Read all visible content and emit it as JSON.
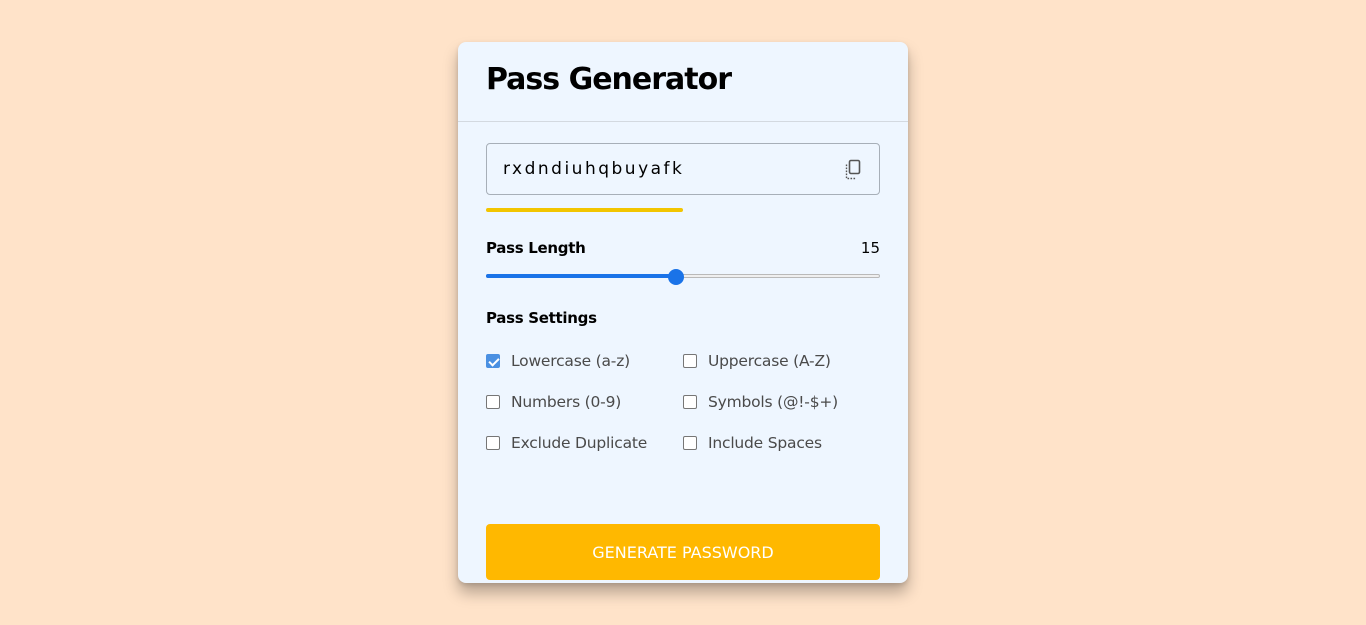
{
  "app": {
    "title": "Pass Generator"
  },
  "password": {
    "value": "rxdndiuhqbuyafk",
    "copy_icon": "copy-icon",
    "strength_fraction": 0.5,
    "strength_color": "#f2c500"
  },
  "length": {
    "label": "Pass Length",
    "value": "15",
    "min": 1,
    "max": 30,
    "current": 15,
    "accent": "#1a73e8"
  },
  "settings": {
    "label": "Pass Settings",
    "options": [
      {
        "label": "Lowercase (a-z)",
        "checked": true
      },
      {
        "label": "Uppercase (A-Z)",
        "checked": false
      },
      {
        "label": "Numbers (0-9)",
        "checked": false
      },
      {
        "label": "Symbols (@!-$+)",
        "checked": false
      },
      {
        "label": "Exclude Duplicate",
        "checked": false
      },
      {
        "label": "Include Spaces",
        "checked": false
      }
    ]
  },
  "generate": {
    "label": "GENERATE PASSWORD",
    "color": "#ffb800"
  },
  "colors": {
    "page_background": "#ffe3c9",
    "card_background": "#eef6ff"
  }
}
